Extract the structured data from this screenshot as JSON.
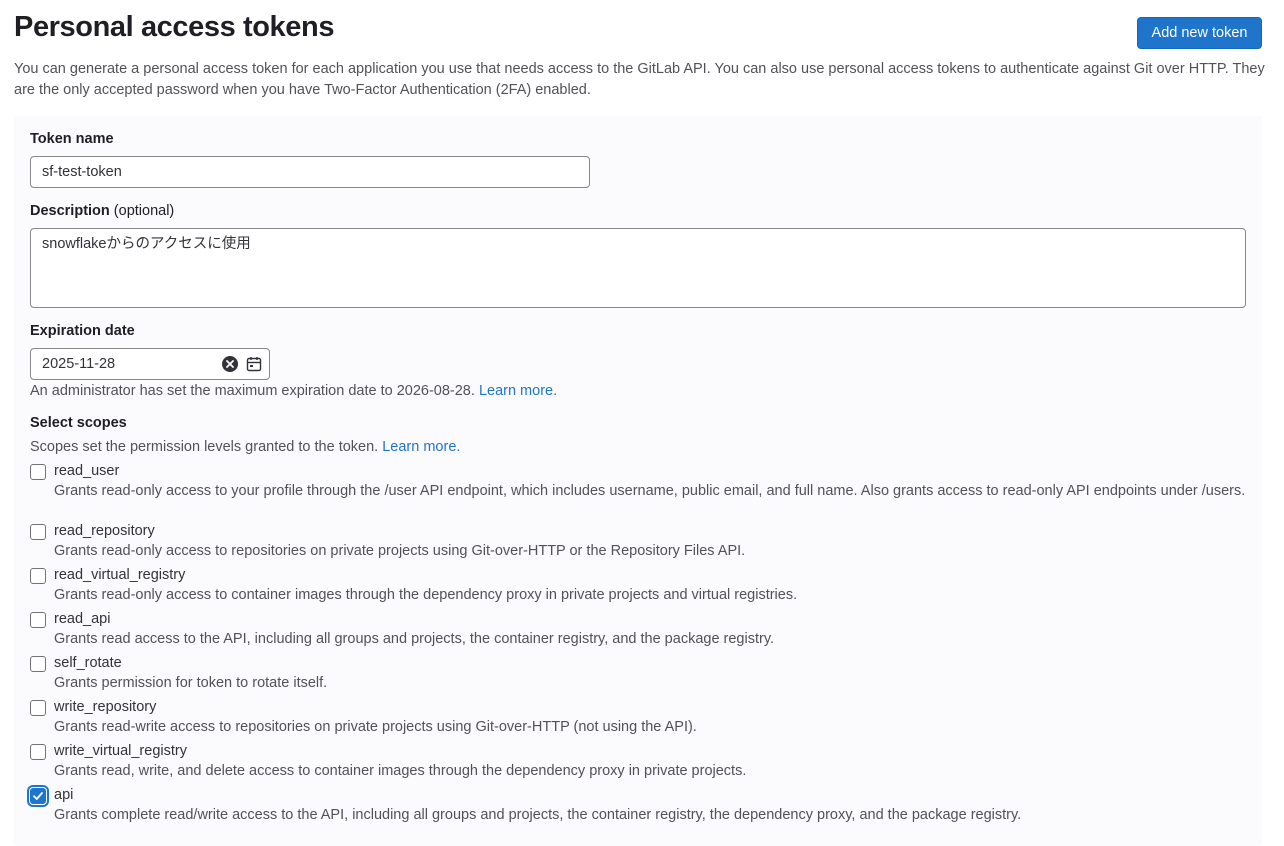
{
  "header": {
    "title": "Personal access tokens",
    "add_button": "Add new token",
    "intro": "You can generate a personal access token for each application you use that needs access to the GitLab API. You can also use personal access tokens to authenticate against Git over HTTP. They are the only accepted password when you have Two-Factor Authentication (2FA) enabled."
  },
  "form": {
    "token_name": {
      "label": "Token name",
      "value": "sf-test-token"
    },
    "description": {
      "label": "Description",
      "optional": "(optional)",
      "value": "snowflakeからのアクセスに使用"
    },
    "expiration": {
      "label": "Expiration date",
      "value": "2025-11-28",
      "help": "An administrator has set the maximum expiration date to 2026-08-28.",
      "help_link": "Learn more."
    },
    "scopes": {
      "label": "Select scopes",
      "help": "Scopes set the permission levels granted to the token.",
      "help_link": "Learn more.",
      "items": [
        {
          "name": "read_user",
          "checked": false,
          "desc": "Grants read-only access to your profile through the /user API endpoint, which includes username, public email, and full name. Also grants access to read-only API endpoints under /users."
        },
        {
          "name": "read_repository",
          "checked": false,
          "desc": "Grants read-only access to repositories on private projects using Git-over-HTTP or the Repository Files API."
        },
        {
          "name": "read_virtual_registry",
          "checked": false,
          "desc": "Grants read-only access to container images through the dependency proxy in private projects and virtual registries."
        },
        {
          "name": "read_api",
          "checked": false,
          "desc": "Grants read access to the API, including all groups and projects, the container registry, and the package registry."
        },
        {
          "name": "self_rotate",
          "checked": false,
          "desc": "Grants permission for token to rotate itself."
        },
        {
          "name": "write_repository",
          "checked": false,
          "desc": "Grants read-write access to repositories on private projects using Git-over-HTTP (not using the API)."
        },
        {
          "name": "write_virtual_registry",
          "checked": false,
          "desc": "Grants read, write, and delete access to container images through the dependency proxy in private projects."
        },
        {
          "name": "api",
          "checked": true,
          "desc": "Grants complete read/write access to the API, including all groups and projects, the container registry, the dependency proxy, and the package registry."
        }
      ]
    }
  }
}
